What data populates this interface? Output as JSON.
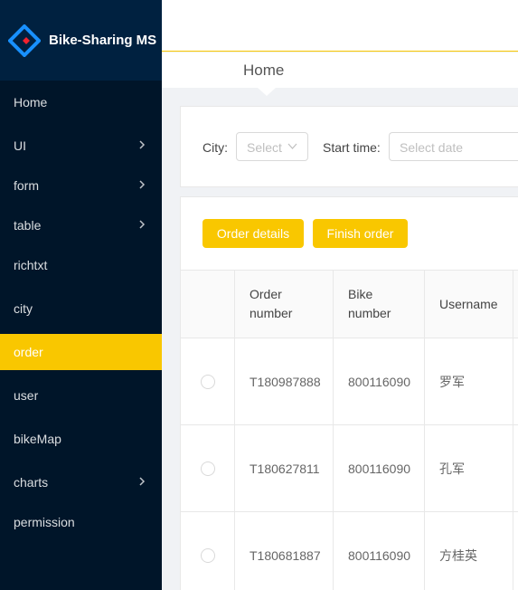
{
  "app": {
    "title": "Bike-Sharing MS",
    "accent": "#f9c700",
    "sidebar_bg": "#001529"
  },
  "sidebar": {
    "items": [
      {
        "label": "Home",
        "has_submenu": false,
        "active": false
      },
      {
        "label": "UI",
        "has_submenu": true,
        "active": false
      },
      {
        "label": "form",
        "has_submenu": true,
        "active": false
      },
      {
        "label": "table",
        "has_submenu": true,
        "active": false
      },
      {
        "label": "richtxt",
        "has_submenu": false,
        "active": false
      },
      {
        "label": "city",
        "has_submenu": false,
        "active": false
      },
      {
        "label": "order",
        "has_submenu": false,
        "active": true
      },
      {
        "label": "user",
        "has_submenu": false,
        "active": false
      },
      {
        "label": "bikeMap",
        "has_submenu": false,
        "active": false
      },
      {
        "label": "charts",
        "has_submenu": true,
        "active": false
      },
      {
        "label": "permission",
        "has_submenu": false,
        "active": false
      }
    ]
  },
  "breadcrumb": {
    "title": "Home"
  },
  "filter": {
    "city_label": "City:",
    "city_placeholder": "Select",
    "start_time_label": "Start time:",
    "start_time_placeholder": "Select date"
  },
  "actions": {
    "order_details_label": "Order details",
    "finish_order_label": "Finish order"
  },
  "table": {
    "columns": [
      "Order number",
      "Bike number",
      "Username"
    ],
    "rows": [
      {
        "order_number": "T180987888",
        "bike_number": "800116090",
        "username": "罗军"
      },
      {
        "order_number": "T180627811",
        "bike_number": "800116090",
        "username": "孔军"
      },
      {
        "order_number": "T180681887",
        "bike_number": "800116090",
        "username": "方桂英"
      }
    ]
  }
}
